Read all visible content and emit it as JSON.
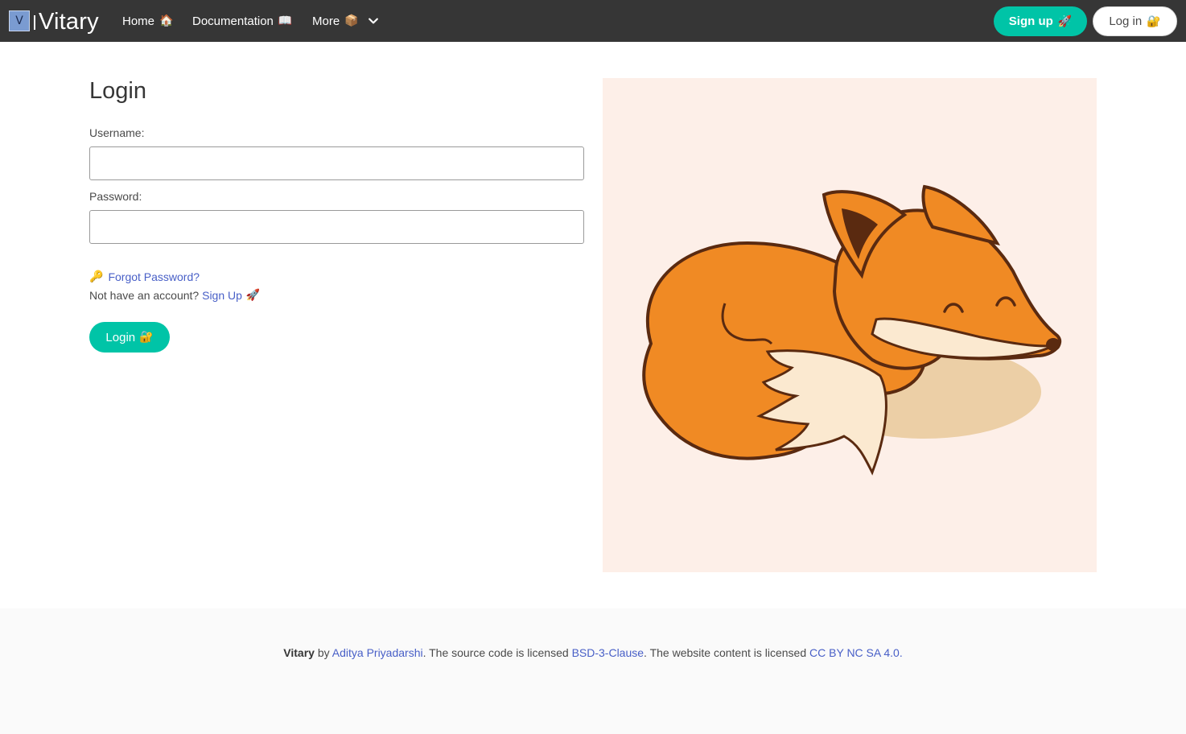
{
  "navbar": {
    "logo_letter": "V",
    "brand": "Vitary",
    "items": [
      {
        "label": "Home",
        "icon": "🏠"
      },
      {
        "label": "Documentation",
        "icon": "📖"
      },
      {
        "label": "More",
        "icon": "📦"
      }
    ],
    "signup_label": "Sign up",
    "signup_icon": "🚀",
    "login_label": "Log in",
    "login_icon": "🔐"
  },
  "form": {
    "title": "Login",
    "username_label": "Username:",
    "username_value": "",
    "password_label": "Password:",
    "password_value": "",
    "forgot_icon": "🔑",
    "forgot_label": "Forgot Password?",
    "no_account_text": "Not have an account?",
    "signup_link": "Sign Up",
    "signup_icon": "🚀",
    "submit_label": "Login",
    "submit_icon": "🔐"
  },
  "illustration": {
    "subject": "sleeping-fox",
    "background": "#fdefe8",
    "fox_color": "#f08a24",
    "shadow_color": "#eccfa6"
  },
  "footer": {
    "brand": "Vitary",
    "by": "by",
    "author": "Aditya Priyadarshi",
    "text1": ". The source code is licensed",
    "code_license": "BSD-3-Clause",
    "text2": ". The website content is licensed",
    "content_license": "CC BY NC SA 4.0",
    "text3": "."
  },
  "colors": {
    "navbar_bg": "#363636",
    "primary": "#00c4a7",
    "link": "#485fc7",
    "footer_bg": "#fafafa"
  }
}
